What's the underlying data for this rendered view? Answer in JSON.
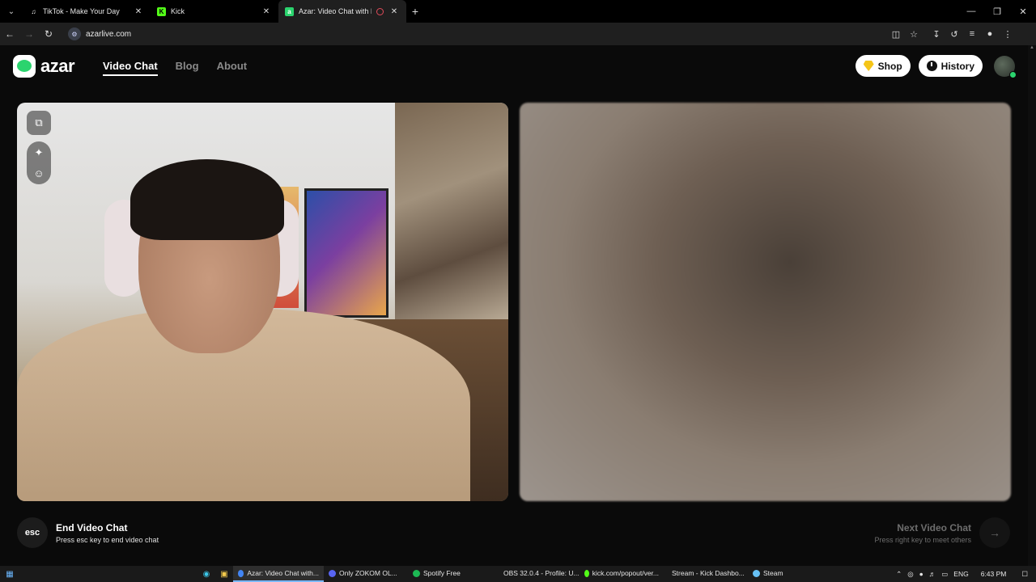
{
  "browser": {
    "tabs": [
      {
        "title": "TikTok - Make Your Day",
        "favicon": "tiktok-icon",
        "active": false
      },
      {
        "title": "Kick",
        "favicon": "kick-icon",
        "active": false
      },
      {
        "title": "Azar: Video Chat with New",
        "favicon": "azar-icon",
        "active": true
      }
    ],
    "url": "azarlive.com"
  },
  "site": {
    "logo_text": "azar",
    "nav": [
      "Video Chat",
      "Blog",
      "About"
    ],
    "shop_label": "Shop",
    "history_label": "History"
  },
  "footer": {
    "esc_key": "esc",
    "end_title": "End Video Chat",
    "end_sub": "Press esc key to end video chat",
    "next_title": "Next Video Chat",
    "next_sub": "Press right key to meet others"
  },
  "taskbar": {
    "apps": [
      {
        "label": "Azar: Video Chat with...",
        "icon": "chrome-icon",
        "color": "#4285f4",
        "active": true
      },
      {
        "label": "Only ZOKOM OL...",
        "icon": "discord-icon",
        "color": "#5865f2",
        "active": false
      },
      {
        "label": "Spotify Free",
        "icon": "spotify-icon",
        "color": "#1db954",
        "active": false
      },
      {
        "label": "OBS 32.0.4 - Profile: U...",
        "icon": "obs-icon",
        "color": "#cccccc",
        "active": false
      },
      {
        "label": "kick.com/popout/ver...",
        "icon": "kick-icon",
        "color": "#53fc18",
        "active": false
      },
      {
        "label": "Stream - Kick Dashbo...",
        "icon": "chrome-icon",
        "color": "#4285f4",
        "active": false
      },
      {
        "label": "Steam",
        "icon": "steam-icon",
        "color": "#66c0f4",
        "active": false
      }
    ],
    "lang": "ENG",
    "time": "6:43 PM"
  }
}
